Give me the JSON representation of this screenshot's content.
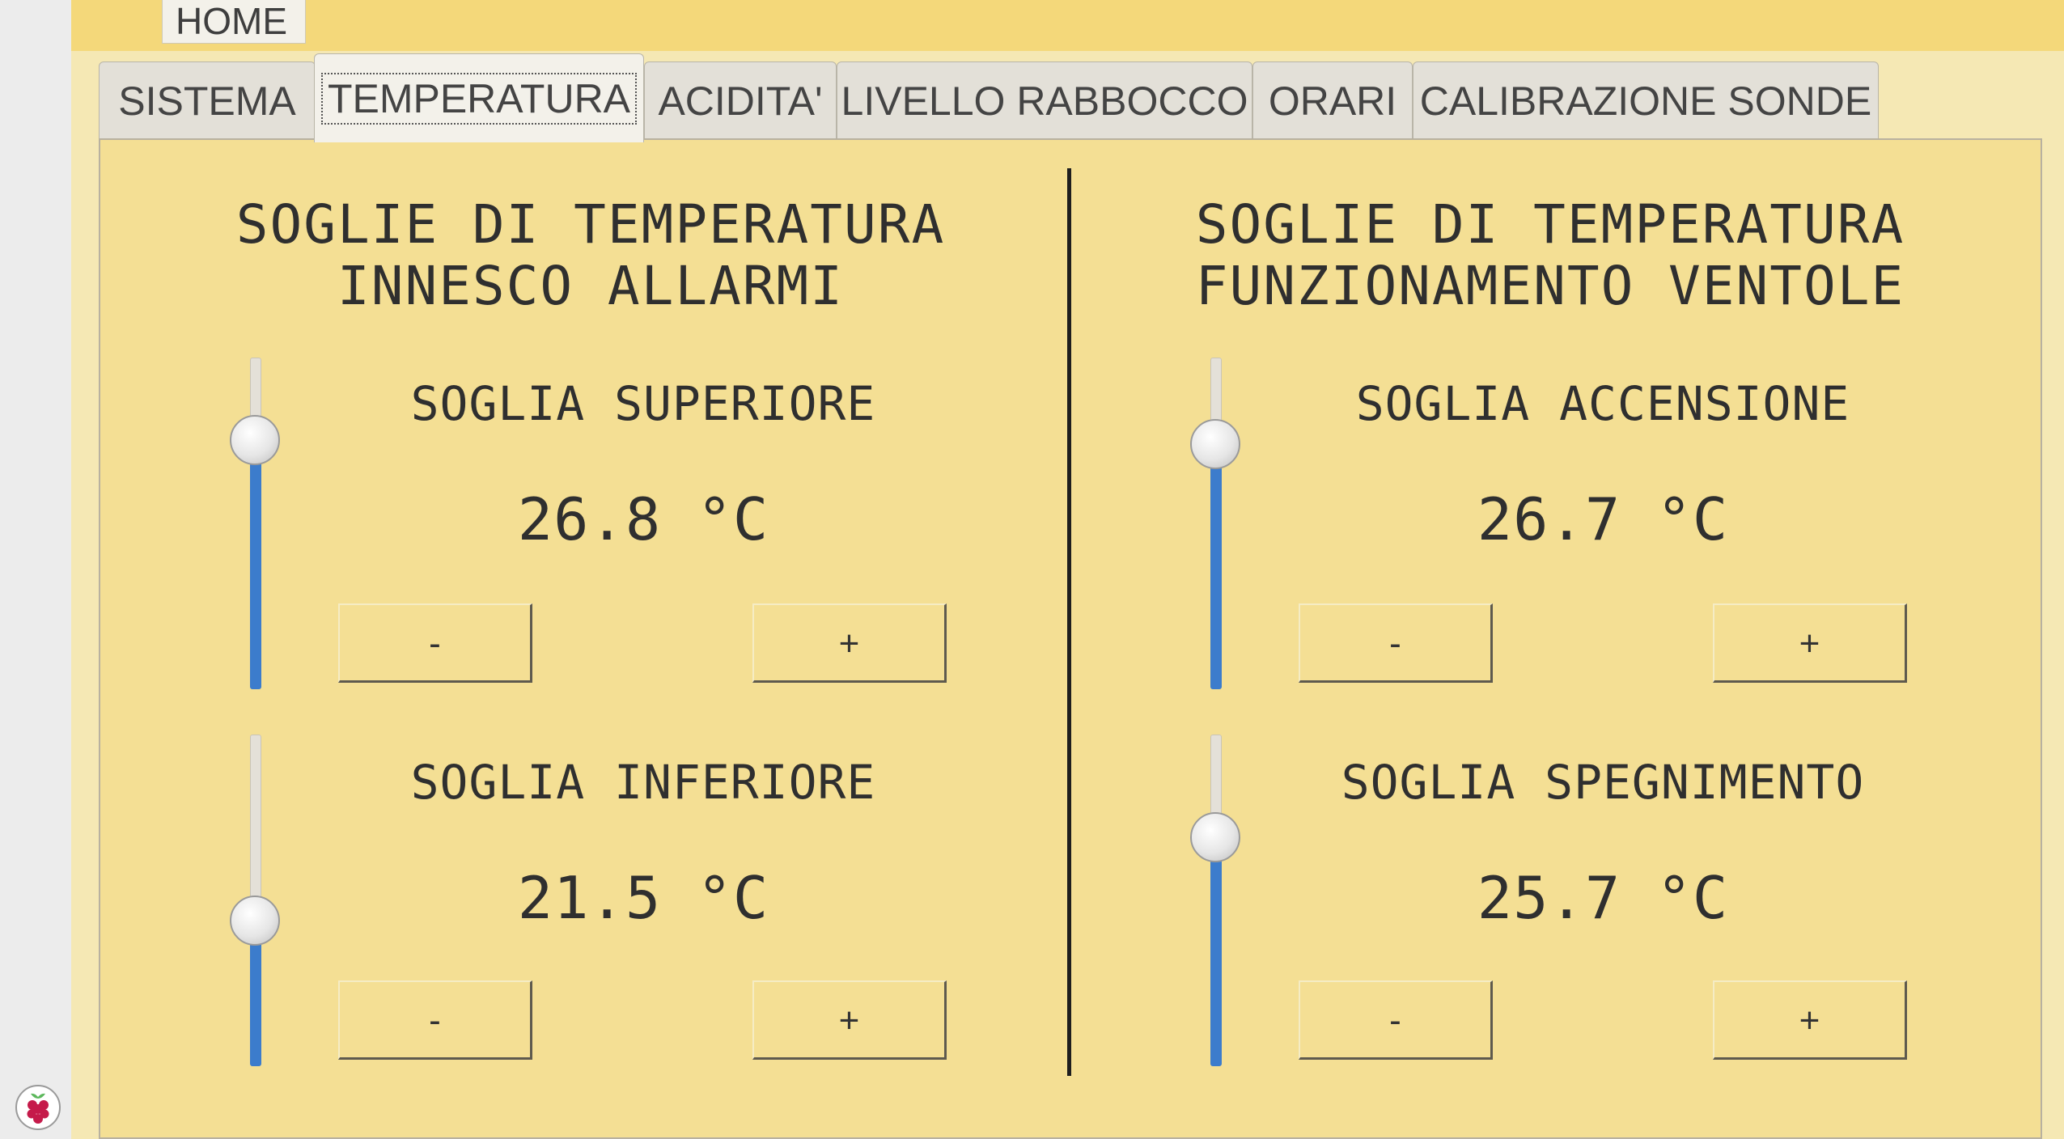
{
  "home_tab": "HOME",
  "tabs": [
    {
      "label": "SISTEMA",
      "active": false
    },
    {
      "label": "TEMPERATURA",
      "active": true
    },
    {
      "label": "ACIDITA'",
      "active": false
    },
    {
      "label": "LIVELLO RABBOCCO",
      "active": false
    },
    {
      "label": "ORARI",
      "active": false
    },
    {
      "label": "CALIBRAZIONE SONDE",
      "active": false
    }
  ],
  "alarms": {
    "title": "SOGLIE DI TEMPERATURA\nINNESCO ALLARMI",
    "upper": {
      "label": "SOGLIA SUPERIORE",
      "value": "26.8 °C",
      "slider_level": 0.75,
      "minus": "-",
      "plus": "+"
    },
    "lower": {
      "label": "SOGLIA INFERIORE",
      "value": "21.5 °C",
      "slider_level": 0.44,
      "minus": "-",
      "plus": "+"
    }
  },
  "fans": {
    "title": "SOGLIE DI TEMPERATURA\nFUNZIONAMENTO VENTOLE",
    "on": {
      "label": "SOGLIA ACCENSIONE",
      "value": "26.7 °C",
      "slider_level": 0.74,
      "minus": "-",
      "plus": "+"
    },
    "off": {
      "label": "SOGLIA SPEGNIMENTO",
      "value": "25.7 °C",
      "slider_level": 0.69,
      "minus": "-",
      "plus": "+"
    }
  },
  "colors": {
    "header_bar": "#f4d87a",
    "panel": "#f4df94",
    "slider_fill": "#3c7ccc"
  },
  "icons": {
    "taskbar_logo": "raspberry-pi-icon"
  }
}
